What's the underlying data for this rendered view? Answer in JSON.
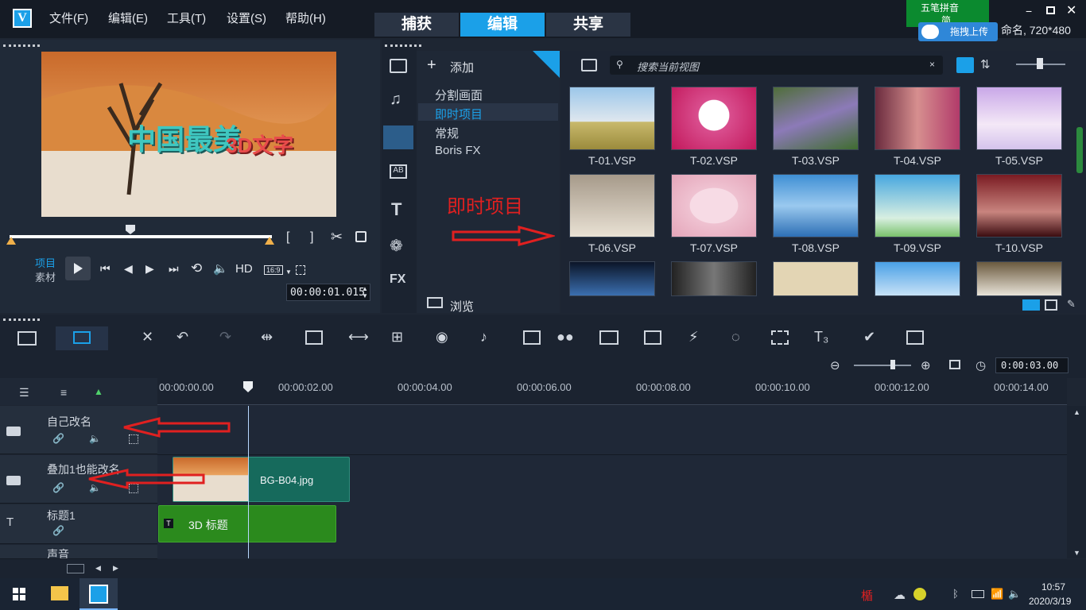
{
  "menu": [
    "文件(F)",
    "编辑(E)",
    "工具(T)",
    "设置(S)",
    "帮助(H)"
  ],
  "tabs": {
    "capture": "捕获",
    "edit": "编辑",
    "share": "共享"
  },
  "ime": {
    "name": "五笔拼音",
    "mode": "简",
    "upload": "拖拽上传"
  },
  "project_info": "命名, 720*480",
  "preview": {
    "title_text_a": "中国最美",
    "title_text_b": "3D文字",
    "mode_project": "项目",
    "mode_clip": "素材",
    "hd_label": "HD",
    "aspect": "16:9",
    "timecode": "00:00:01.015"
  },
  "library": {
    "add_label": "添加",
    "categories": [
      "分割画面",
      "即时项目",
      "常规",
      "Boris FX"
    ],
    "annotation": "即时项目",
    "browse_label": "浏览",
    "search_placeholder": "搜索当前视图",
    "thumbs": [
      "T-01.VSP",
      "T-02.VSP",
      "T-03.VSP",
      "T-04.VSP",
      "T-05.VSP",
      "T-06.VSP",
      "T-07.VSP",
      "T-08.VSP",
      "T-09.VSP",
      "T-10.VSP"
    ]
  },
  "timeline": {
    "duration": "0:00:03.00",
    "ruler": [
      "00:00:00.00",
      "00:00:02.00",
      "00:00:04.00",
      "00:00:06.00",
      "00:00:08.00",
      "00:00:10.00",
      "00:00:12.00",
      "00:00:14.00"
    ],
    "tracks": [
      "自己改名",
      "叠加1也能改名",
      "标题1",
      "声音"
    ],
    "overlay_clip": "BG-B04.jpg",
    "title_clip": "3D 标题"
  },
  "taskbar": {
    "time": "10:57",
    "date": "2020/3/19"
  },
  "colors": {
    "accent": "#1ba0e8",
    "overlay_clip": "#166a5c",
    "title_clip": "#2b8a1d",
    "annotation": "#e02020"
  }
}
